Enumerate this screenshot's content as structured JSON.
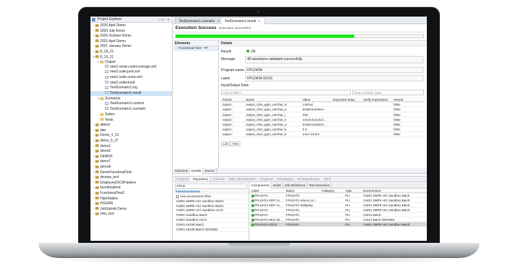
{
  "explorer": {
    "title": "Project Explorer",
    "items": [
      {
        "label": "2020 April Demo",
        "depth": 0,
        "kind": "proj",
        "expander": ">"
      },
      {
        "label": "2020 July Demo",
        "depth": 0,
        "kind": "proj",
        "expander": ">"
      },
      {
        "label": "2020 October Demo",
        "depth": 0,
        "kind": "proj",
        "expander": ">"
      },
      {
        "label": "2021 April Demo",
        "depth": 0,
        "kind": "proj",
        "expander": ">"
      },
      {
        "label": "2021 January Demo",
        "depth": 0,
        "kind": "proj",
        "expander": ">"
      },
      {
        "label": "8_18_21",
        "depth": 0,
        "kind": "proj",
        "expander": ">"
      },
      {
        "label": "8_19_21",
        "depth": 0,
        "kind": "proj",
        "expander": "v"
      },
      {
        "label": "Output",
        "depth": 1,
        "kind": "folder",
        "expander": "v"
      },
      {
        "label": "new2.sonar.codecoverage.xml",
        "depth": 2,
        "kind": "file",
        "expander": ""
      },
      {
        "label": "new2.suite.junit.xml",
        "depth": 2,
        "kind": "file",
        "expander": ""
      },
      {
        "label": "new2.suite.sonar.xml",
        "depth": 2,
        "kind": "file",
        "expander": ""
      },
      {
        "label": "new2.suiteresult",
        "depth": 2,
        "kind": "file",
        "expander": ""
      },
      {
        "label": "TestScenario1.log",
        "depth": 2,
        "kind": "file",
        "expander": ""
      },
      {
        "label": "TestScenario1.result",
        "depth": 2,
        "kind": "file",
        "expander": "",
        "selected": true
      },
      {
        "label": "Scenarios",
        "depth": 1,
        "kind": "folder",
        "expander": "v"
      },
      {
        "label": "TestScenario1.context",
        "depth": 2,
        "kind": "file",
        "expander": ""
      },
      {
        "label": "TestScenario1.scenario",
        "depth": 2,
        "kind": "file",
        "expander": ""
      },
      {
        "label": "Suites",
        "depth": 1,
        "kind": "folder",
        "expander": ">"
      },
      {
        "label": "Tests",
        "depth": 1,
        "kind": "folder",
        "expander": ">"
      },
      {
        "label": "abend",
        "depth": 0,
        "kind": "proj",
        "expander": ">"
      },
      {
        "label": "dan",
        "depth": 0,
        "kind": "proj",
        "expander": ">"
      },
      {
        "label": "Demo_1_21",
        "depth": 0,
        "kind": "proj",
        "expander": ">"
      },
      {
        "label": "demo_5_27",
        "depth": 0,
        "kind": "proj",
        "expander": ">"
      },
      {
        "label": "demo1",
        "depth": 0,
        "kind": "proj",
        "expander": ">"
      },
      {
        "label": "demo5",
        "depth": 0,
        "kind": "proj",
        "expander": ">"
      },
      {
        "label": "DEMO6",
        "depth": 0,
        "kind": "proj",
        "expander": ">"
      },
      {
        "label": "demo7",
        "depth": 0,
        "kind": "proj",
        "expander": ">"
      },
      {
        "label": "demo8",
        "depth": 0,
        "kind": "proj",
        "expander": ">"
      },
      {
        "label": "DemoFunctionalTest",
        "depth": 0,
        "kind": "proj",
        "expander": ">"
      },
      {
        "label": "devops_test",
        "depth": 0,
        "kind": "proj",
        "expander": ">"
      },
      {
        "label": "EmployeeDICSPipeline",
        "depth": 0,
        "kind": "proj",
        "expander": ">"
      },
      {
        "label": "functionaltest",
        "depth": 0,
        "kind": "proj",
        "expander": ">"
      },
      {
        "label": "FunctionalTest2",
        "depth": 0,
        "kind": "proj",
        "expander": ">"
      },
      {
        "label": "HipeStation",
        "depth": 0,
        "kind": "proj",
        "expander": ">"
      },
      {
        "label": "HOGAN",
        "depth": 0,
        "kind": "proj",
        "expander": ">"
      },
      {
        "label": "JobSubmit Demo",
        "depth": 0,
        "kind": "proj",
        "expander": ">"
      },
      {
        "label": "new_test",
        "depth": 0,
        "kind": "proj",
        "expander": ">"
      }
    ]
  },
  "editor": {
    "tabs": [
      "TestScenario1.scenario",
      "TestScenario1.result"
    ],
    "title": "Execution Success",
    "subtitle": "Execution Successful",
    "progress": 0.72,
    "elements_header": "Elements",
    "element_item": "Functional Test - TF",
    "details_header": "Details",
    "result_label": "Result:",
    "result_value": "OK",
    "message_label": "Message:",
    "message_value": "All assertions validated successfully",
    "program_label": "Program name:",
    "program_value": "FPLDATA",
    "label_label": "Label:",
    "label_value": "FPLDATA 9/2/21",
    "io_label": "Input/Output Data:",
    "quick_filter": "<Quick filter>",
    "exclude_filter": "Enter exclude value",
    "grid_headers": [
      "Parent",
      "Name",
      "Value",
      "Expected Value",
      "Verify Expression",
      "Hexed"
    ],
    "grid_rows": [
      [
        "output :",
        "output_char_pgm_varchar_a",
        "14short",
        "",
        "",
        "false"
      ],
      [
        "output :",
        "output_char_pgm_varchar_a",
        "64abcnumbers...",
        "",
        "",
        "false"
      ],
      [
        "output :",
        "output_char_pgm_varchar_i",
        "333",
        "",
        "",
        "false"
      ],
      [
        "output :",
        "output_char_pgm_varchar_s",
        "141414141414...",
        "",
        "",
        "false"
      ],
      [
        "output :",
        "output_char_pgm_varchar_a",
        "64abcnumbers...",
        "",
        "",
        "false"
      ],
      [
        "output :",
        "output_char_pgm_varchar_b",
        "3 3",
        "",
        "",
        "false"
      ],
      [
        "output :",
        "output_char_pgm_varchar_b",
        "1414 41414",
        "",
        "",
        "false"
      ]
    ],
    "list_tabs": [
      "List",
      "Tree"
    ],
    "view_tabs": [
      "Overview",
      "Details",
      "Source"
    ]
  },
  "bottom": {
    "tabs": [
      "Problems",
      "Repository",
      "Console",
      "Web Administration",
      "Progress",
      "Git Staging",
      "Git Repositories",
      "JUnit"
    ],
    "search_value": "FPLD",
    "env_header": "Environments",
    "use_filter": "Use environment filter",
    "environments": [
      "CW01 SMPE HCI Sandbox Batch",
      "CW01 SMPE HCI Sandbox Batch",
      "CW01 SMPE HCI Sandbox CICS",
      "CW01 Sandbox Batch",
      "CW01 Sandbox CICS",
      "CW01-16196 Batch",
      "CW01-16196 Batch NONDB2"
    ],
    "right_tabs": [
      "Components",
      "Stubs",
      "Job Definitions",
      "Test Scenarios"
    ],
    "table_headers": [
      "Label",
      "Name",
      "Category",
      "Type",
      "Environment"
    ],
    "table_rows": [
      [
        "FPLDATX",
        "FPLDATX",
        "",
        "PLI",
        "CW01 SMPE HCI Sandbox Batch"
      ],
      [
        "FPLDATA 2007 v1...",
        "FPLDATA returns on...",
        "",
        "PLI",
        "CW01 SMPE HCI Sandbox Batch"
      ],
      [
        "FPLDATA 2007 v1...",
        "FPLDATA oldlaptop",
        "",
        "PLI",
        "CW01 SMPE HCI Sandbox Batch"
      ],
      [
        "FPLDATA",
        "FPLDATA",
        "",
        "PLI",
        "CW01 SMPE HCI Sandbox Batch"
      ],
      [
        "FPLDATA",
        "FPLDATA",
        "",
        "PLI",
        "CW13 Batch"
      ],
      [
        "FPLDATA 0812 de...",
        "FPLDATA",
        "",
        "PLI",
        "CW13 Batch NONDB2"
      ],
      [
        "FPLDATA 9/2/21",
        "FPLDATA",
        "",
        "PLI",
        "CW01 SMPE HCI Sandbox Batch"
      ]
    ]
  }
}
